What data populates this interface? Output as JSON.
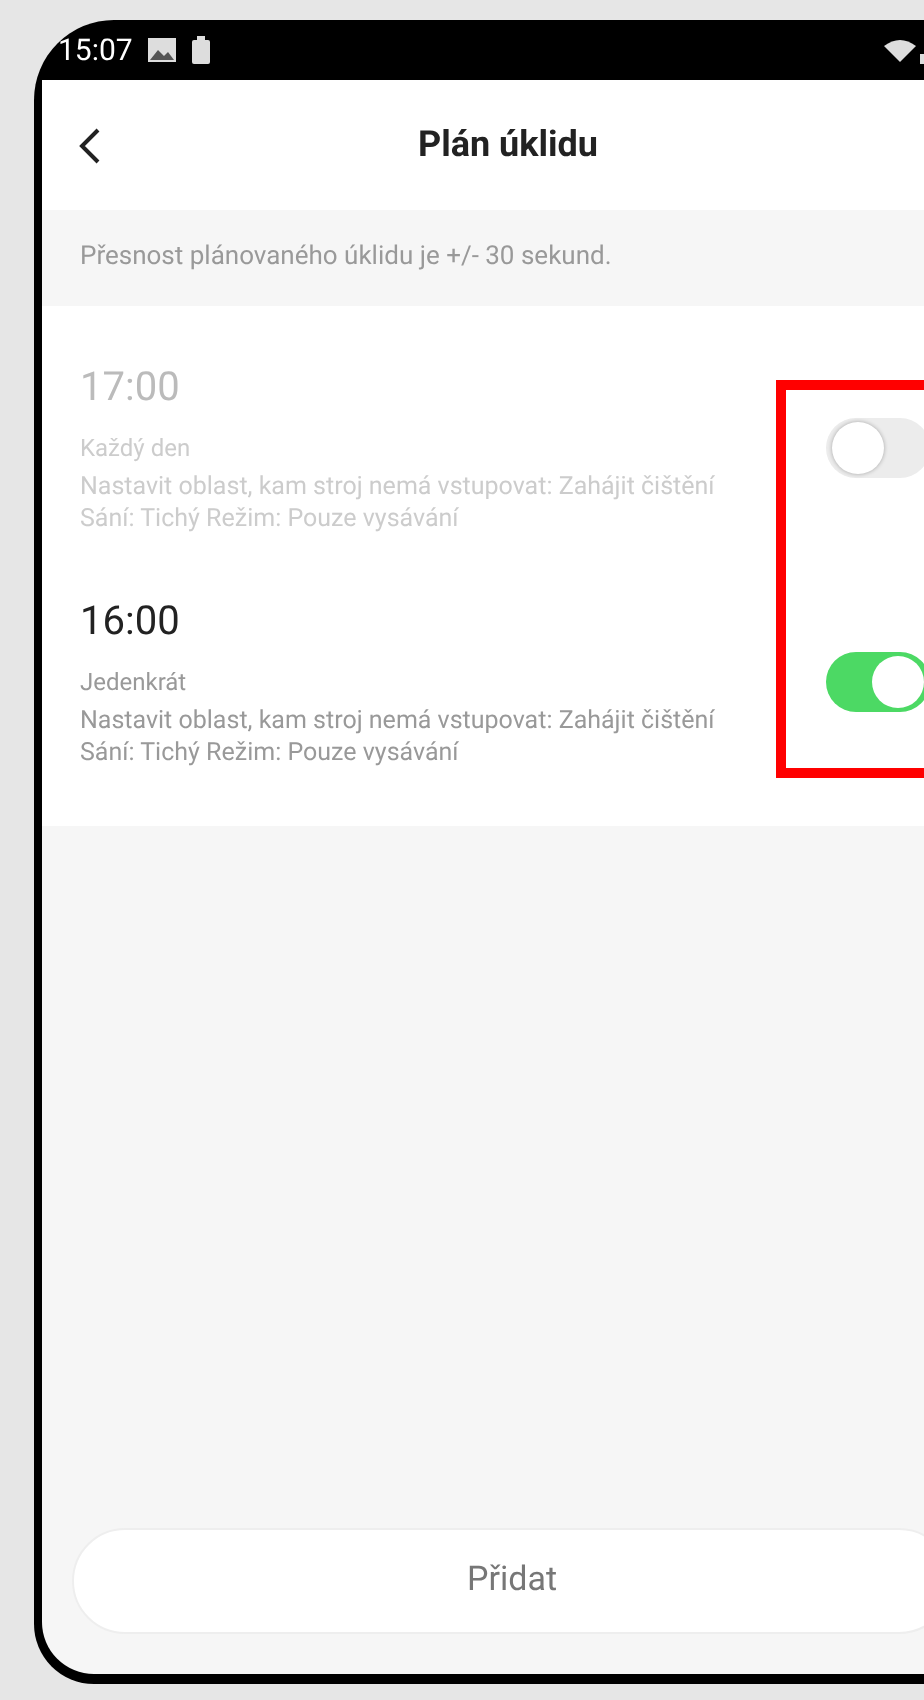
{
  "status_bar": {
    "time": "15:07"
  },
  "header": {
    "title": "Plán úklidu"
  },
  "note": "Přesnost plánovaného úklidu je +/- 30 sekund.",
  "schedules": [
    {
      "time": "17:00",
      "repeat": "Každý den",
      "details": "Nastavit oblast, kam stroj nemá vstupovat: Zahájit čištění Sání: Tichý Režim: Pouze vysávání",
      "on": false
    },
    {
      "time": "16:00",
      "repeat": "Jedenkrát",
      "details": "Nastavit oblast, kam stroj nemá vstupovat: Zahájit čištění Sání: Tichý Režim: Pouze vysávání",
      "on": true
    }
  ],
  "add_button": "Přidat"
}
